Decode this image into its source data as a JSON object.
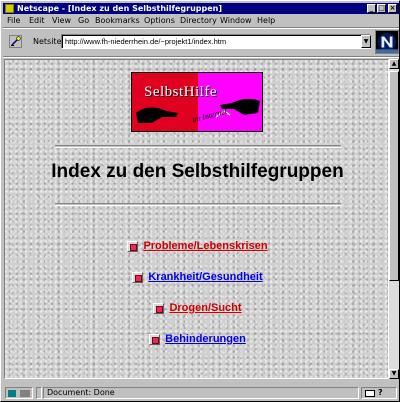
{
  "window": {
    "title": "Netscape - [Index zu den Selbsthilfegruppen]",
    "controls": {
      "minimize": "_",
      "maximize": "□",
      "close": "×"
    }
  },
  "menu": [
    {
      "label": "File"
    },
    {
      "label": "Edit"
    },
    {
      "label": "View"
    },
    {
      "label": "Go"
    },
    {
      "label": "Bookmarks"
    },
    {
      "label": "Options"
    },
    {
      "label": "Directory"
    },
    {
      "label": "Window"
    },
    {
      "label": "Help"
    }
  ],
  "location": {
    "label": "Netsite:",
    "url": "http://www.fh-niederrhein.de/~projekt1/index.htm",
    "icon": "bookmark-link-icon",
    "dropdown_icon": "chevron-down-icon"
  },
  "page": {
    "banner": {
      "logo_text": "SelbstHilfe",
      "sub_text": "im Internet"
    },
    "heading": "Index zu den Selbsthilfegruppen",
    "links": [
      {
        "label": "Probleme/Lebenskrisen",
        "visited": true
      },
      {
        "label": "Krankheit/Gesundheit",
        "visited": false
      },
      {
        "label": "Drogen/Sucht",
        "visited": true
      },
      {
        "label": "Behinderungen",
        "visited": false
      }
    ]
  },
  "status": {
    "text": "Document: Done"
  },
  "colors": {
    "titlebar": "#000080",
    "visited_link": "#d00000",
    "unvisited_link": "#0000ee",
    "banner_red": "#e00020",
    "banner_pink": "#ff00ff"
  }
}
